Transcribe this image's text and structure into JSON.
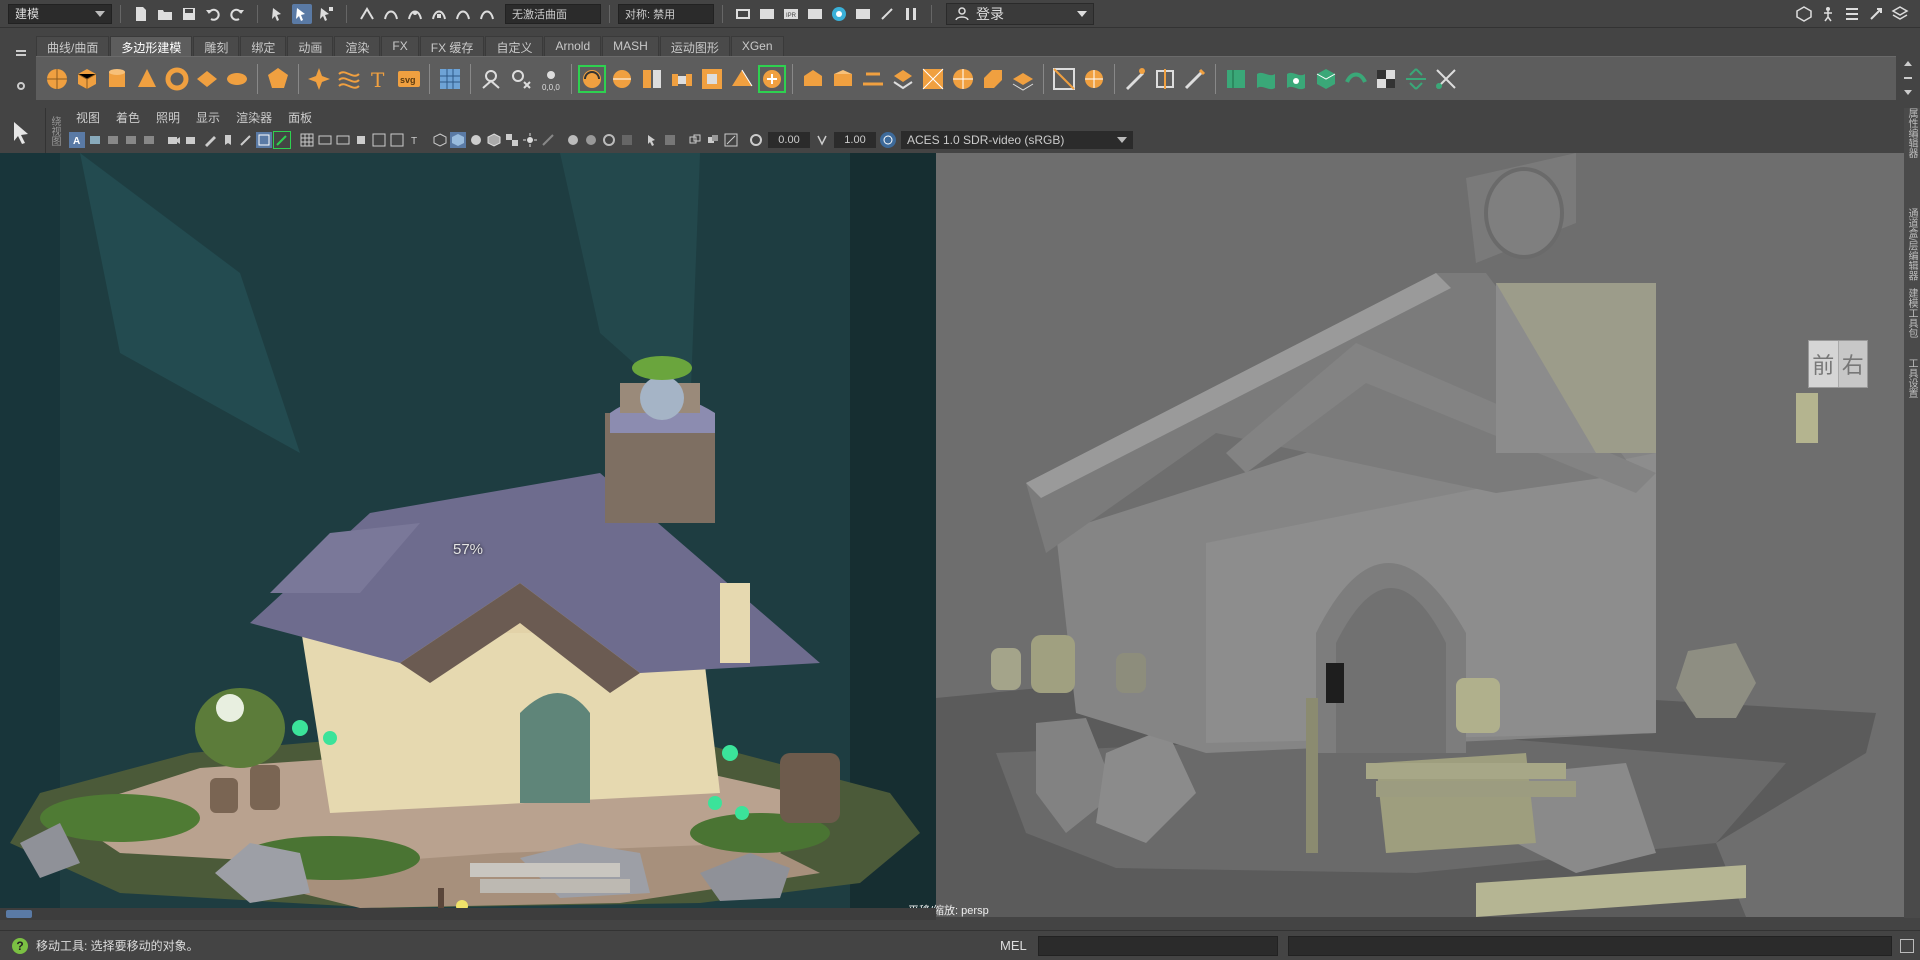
{
  "status_line": {
    "mode_menu": "建模",
    "live_surface": "无激活曲面",
    "symmetry": "对称: 禁用",
    "login": "登录"
  },
  "shelf": {
    "tabs": [
      "曲线/曲面",
      "多边形建模",
      "雕刻",
      "绑定",
      "动画",
      "渲染",
      "FX",
      "FX 缓存",
      "自定义",
      "Arnold",
      "MASH",
      "运动图形",
      "XGen"
    ],
    "active_tab": "多边形建模",
    "type_icon_text": "svg"
  },
  "panel": {
    "menu": [
      "视图",
      "着色",
      "照明",
      "显示",
      "渲染器",
      "面板"
    ],
    "exposure": "0.00",
    "gamma": "1.00",
    "color_space": "ACES 1.0 SDR-video (sRGB)"
  },
  "viewport": {
    "image_plane_zoom": "57%",
    "camera_label": "平移/缩放: persp",
    "viewcube_front": "前",
    "viewcube_right": "右"
  },
  "side_strips": {
    "left_label": "绕视图",
    "right_tabs": [
      "属性编辑器",
      "通道盒/层编辑器",
      "建模工具包",
      "工具设置"
    ]
  },
  "help_line": {
    "text": "移动工具: 选择要移动的对象。",
    "mel_label": "MEL"
  },
  "colors": {
    "accent_orange": "#f0a040",
    "selection_green": "#2ed150",
    "active_blue": "#5a7aa5",
    "ui_background": "#444444"
  }
}
